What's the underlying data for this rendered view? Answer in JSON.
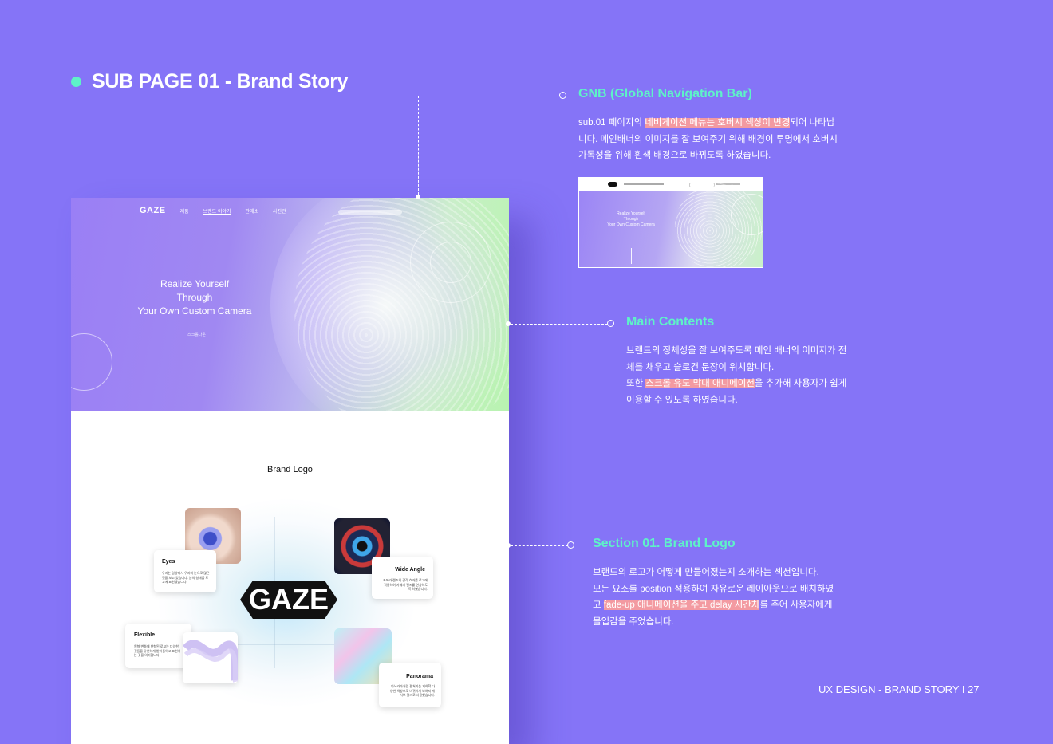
{
  "page": {
    "title": "SUB PAGE 01 - Brand Story",
    "footer": "UX DESIGN - BRAND STORY I 27"
  },
  "mockup": {
    "nav": {
      "logo": "GAZE",
      "items": [
        "제품",
        "브랜드 이야기",
        "판매소",
        "사진관"
      ],
      "active_index": 1
    },
    "hero": {
      "slogan": [
        "Realize Yourself",
        "Through",
        "Your Own Custom Camera"
      ],
      "scroll_label": "스크롤다운"
    },
    "brand_section": {
      "title": "Brand Logo",
      "logo": "GAZE",
      "cards": [
        {
          "title": "Eyes",
          "text": "우리는 일상에서 우리의 눈으로 많은 것을 보고 있습니다. 눈의 형태를 로고에 표현했습니다."
        },
        {
          "title": "Wide Angle",
          "text": "카메라 렌즈의 광각 효과를 로고에 적용하여 카메라 렌즈를 연상하도록 하였습니다."
        },
        {
          "title": "Flexible",
          "text": "원형 변화에 변형된 로고는 다양한 것들을 유연하게 받아들이고 표현하는 것을 의미합니다."
        },
        {
          "title": "Panorama",
          "text": "파노라마처럼 펼쳐지는 기하학 다양한 색상으로 바뀌어서 보여지 게 서브 컬러로 사용했습니다."
        }
      ]
    }
  },
  "callouts": [
    {
      "title": "GNB (Global Navigation Bar)",
      "lines": [
        {
          "pre": "sub.01 페이지의 ",
          "hl": "네비게이션  메뉴는 호버시 색상이  변경",
          "post": "되어  나타납"
        },
        {
          "pre": "니다.  메인배너의 이미지를 잘 보여주기 위해  배경이 투명에서 호버시",
          "hl": "",
          "post": ""
        },
        {
          "pre": "가독성을 위해 흰색  배경으로  바뀌도록 하였습니다.",
          "hl": "",
          "post": ""
        }
      ],
      "thumb": {
        "slogan": [
          "Realize Yourself",
          "Through",
          "Your Own Custom Camera"
        ]
      }
    },
    {
      "title": "Main Contents",
      "lines": [
        {
          "pre": "브랜드의 정체성을 잘 보여주도록 메인 배너의 이미지가 전",
          "hl": "",
          "post": ""
        },
        {
          "pre": "체를 채우고 슬로건 문장이 위치합니다.",
          "hl": "",
          "post": ""
        },
        {
          "pre": "또한 ",
          "hl": "스크롤 유도 막대 애니메이션",
          "post": "을 추가해 사용자가 쉽게"
        },
        {
          "pre": "이용할 수 있도록 하였습니다.",
          "hl": "",
          "post": ""
        }
      ]
    },
    {
      "title": "Section 01. Brand  Logo",
      "lines": [
        {
          "pre": "브랜드의 로고가 어떻게 만들어졌는지 소개하는 섹션입니다.",
          "hl": "",
          "post": ""
        },
        {
          "pre": "모든 요소를 position 적용하여 자유로운 레이아웃으로 배치하였",
          "hl": "",
          "post": ""
        },
        {
          "pre": "고 ",
          "hl": "fade-up 애니메이션을 주고 delay 시간차",
          "post": "를 주어 사용자에게"
        },
        {
          "pre": "몰입감을 주었습니다.",
          "hl": "",
          "post": ""
        }
      ]
    }
  ],
  "colors": {
    "background": "#8574f7",
    "accent": "#5ef2c8",
    "highlight": "#f39aa1"
  }
}
